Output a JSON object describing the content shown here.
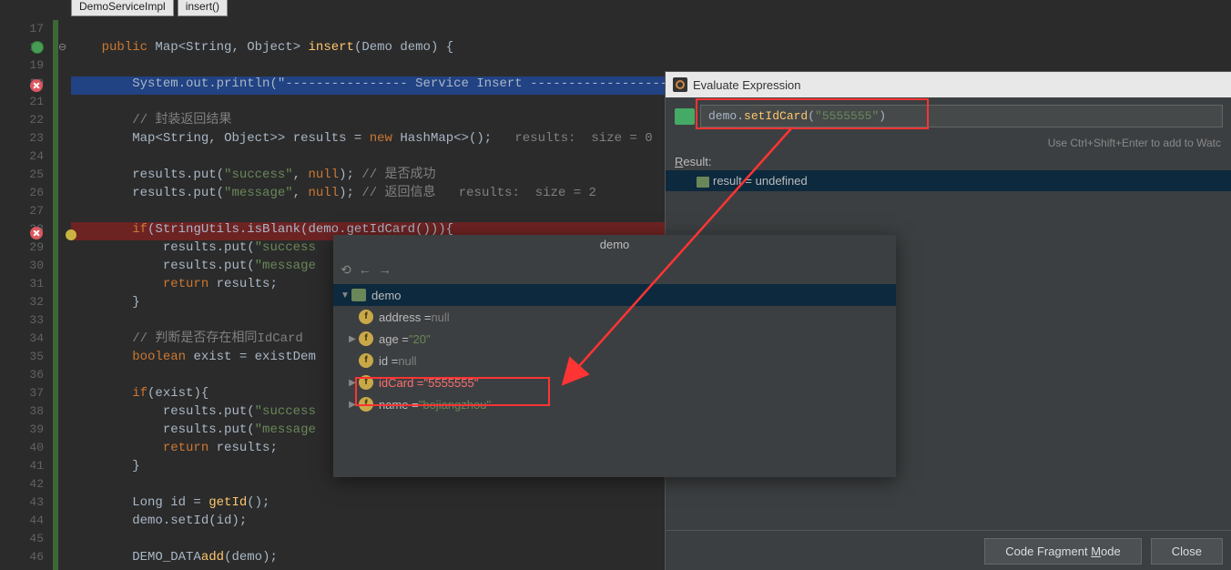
{
  "tabs": {
    "t1": "DemoServiceImpl",
    "t2": "insert()"
  },
  "lines": {
    "start": 17,
    "end": 46,
    "l18": {
      "a": "public ",
      "b": "Map",
      "c": "<",
      "d": "String",
      "e": ", ",
      "f": "Object",
      "g": "> ",
      "h": "insert",
      "i": "(Demo demo) {"
    },
    "l20": "System.out.println(\"---------------- Service Insert ----------------------------------\");",
    "l21": "// 封装返回结果",
    "l22": {
      "a": "Map",
      "b": "<",
      "c": "String",
      "d": ", ",
      "e": "Object",
      "f": "> results = ",
      "g": "new ",
      "h": "HashMap",
      "i": "<>();",
      "j": "   results:  size = 0"
    },
    "l24": {
      "a": "results.put(",
      "b": "\"success\"",
      "c": ", ",
      "d": "null",
      "e": "); ",
      "f": "// 是否成功"
    },
    "l25": {
      "a": "results.put(",
      "b": "\"message\"",
      "c": ", ",
      "d": "null",
      "e": "); ",
      "f": "// 返回信息",
      "g": "   results:  size = 2"
    },
    "l27": {
      "a": "if",
      "b": "(StringUtils.isBlank(demo.getIdCard())){"
    },
    "l28": {
      "a": "results.put(",
      "b": "\"success"
    },
    "l29": {
      "a": "results.put(",
      "b": "\"message"
    },
    "l30": {
      "a": "return ",
      "b": "results;"
    },
    "l31": "}",
    "l33": "// 判断是否存在相同IdCard",
    "l34": {
      "a": "boolean ",
      "b": "exist = existDem"
    },
    "l36": {
      "a": "if",
      "b": "(exist){"
    },
    "l37": {
      "a": "results.put(",
      "b": "\"success"
    },
    "l38": {
      "a": "results.put(",
      "b": "\"message"
    },
    "l39": {
      "a": "return ",
      "b": "results;"
    },
    "l40": "}",
    "l42": {
      "a": "Long id = ",
      "b": "getId",
      "c": "();"
    },
    "l43": "demo.setId(id);",
    "l45": {
      "a": "DEMO_DATA",
      ".": ".",
      "b": "add",
      "c": "(demo);"
    }
  },
  "eval": {
    "title": "Evaluate Expression",
    "expr_a": "demo.",
    "expr_b": "setIdCard",
    "expr_c": "(",
    "expr_d": "\"5555555\"",
    "expr_e": ")",
    "hint": "Use Ctrl+Shift+Enter to add to Watc",
    "result_label_u": "R",
    "result_label_rest": "esult:",
    "result_name": "result",
    "result_eq": " = ",
    "result_val": "undefined",
    "btn_mode_pre": "Code Fragment ",
    "btn_mode_u": "M",
    "btn_mode_post": "ode",
    "btn_close": "Close"
  },
  "demo": {
    "title": "demo",
    "root": "demo",
    "fields": [
      {
        "name": "address",
        "val": "null",
        "type": "null",
        "arrow": false
      },
      {
        "name": "age",
        "val": "\"20\"",
        "type": "str",
        "arrow": true
      },
      {
        "name": "id",
        "val": "null",
        "type": "null",
        "arrow": false
      },
      {
        "name": "idCard",
        "val": "\"5555555\"",
        "type": "str",
        "arrow": true,
        "hl": true
      },
      {
        "name": "name",
        "val": "\"bojiangzhou\"",
        "type": "str",
        "arrow": true
      }
    ]
  },
  "icons": {
    "history": "⟲",
    "back": "←",
    "fwd": "→",
    "tree_down": "▼",
    "tree_right": "▶"
  }
}
